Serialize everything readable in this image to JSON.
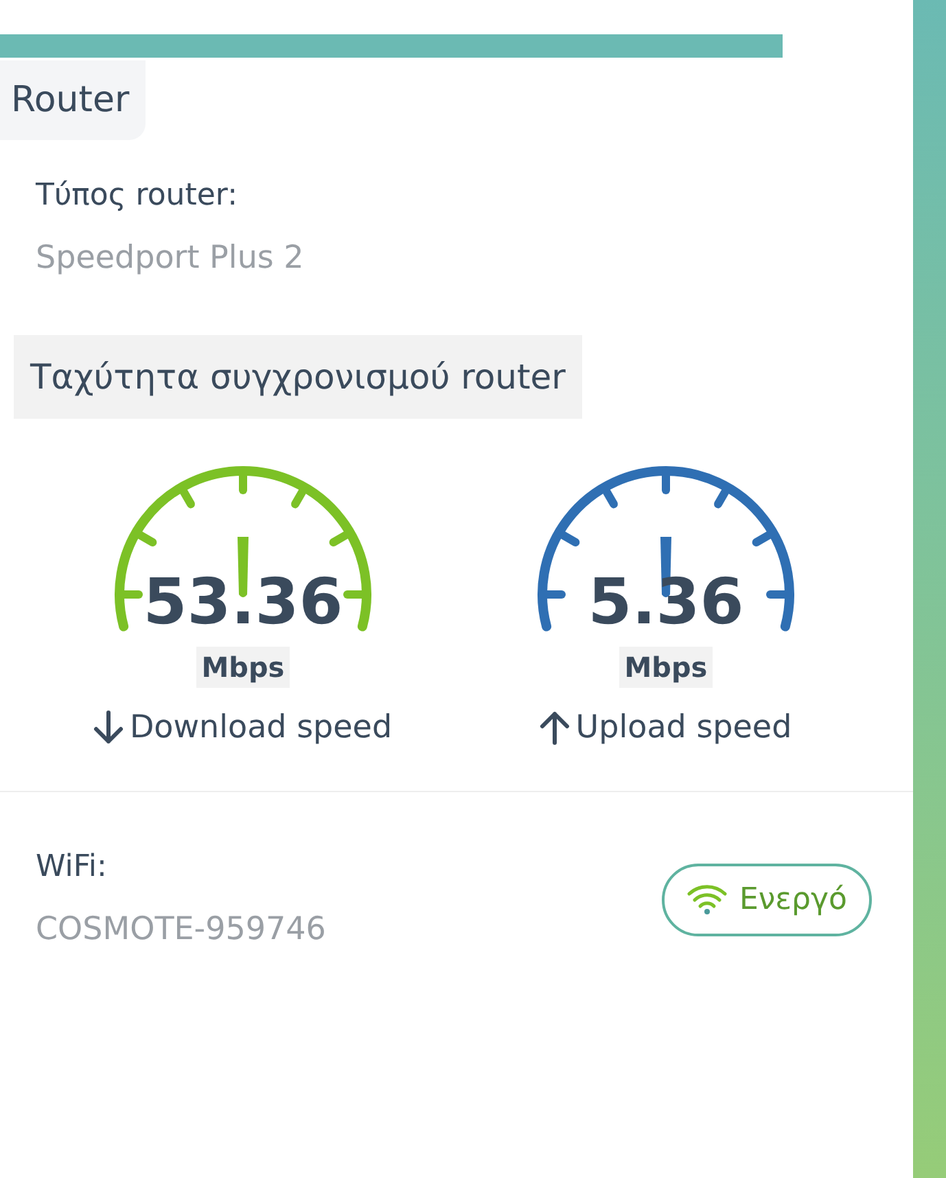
{
  "section_title": "Router",
  "router_type": {
    "label": "Τύπος router:",
    "value": "Speedport Plus 2"
  },
  "speed_title": "Ταχύτητα συγχρονισμού router",
  "gauges": [
    {
      "value": "53.36",
      "unit": "Mbps",
      "label": "Download speed",
      "kind": "down",
      "color": "#7cc126"
    },
    {
      "value": "5.36",
      "unit": "Mbps",
      "label": "Upload speed",
      "kind": "up",
      "color": "#2f6fb3"
    }
  ],
  "wifi": {
    "label": "WiFi:",
    "value": "COSMOTE-959746",
    "status": "Ενεργό",
    "on": true
  }
}
